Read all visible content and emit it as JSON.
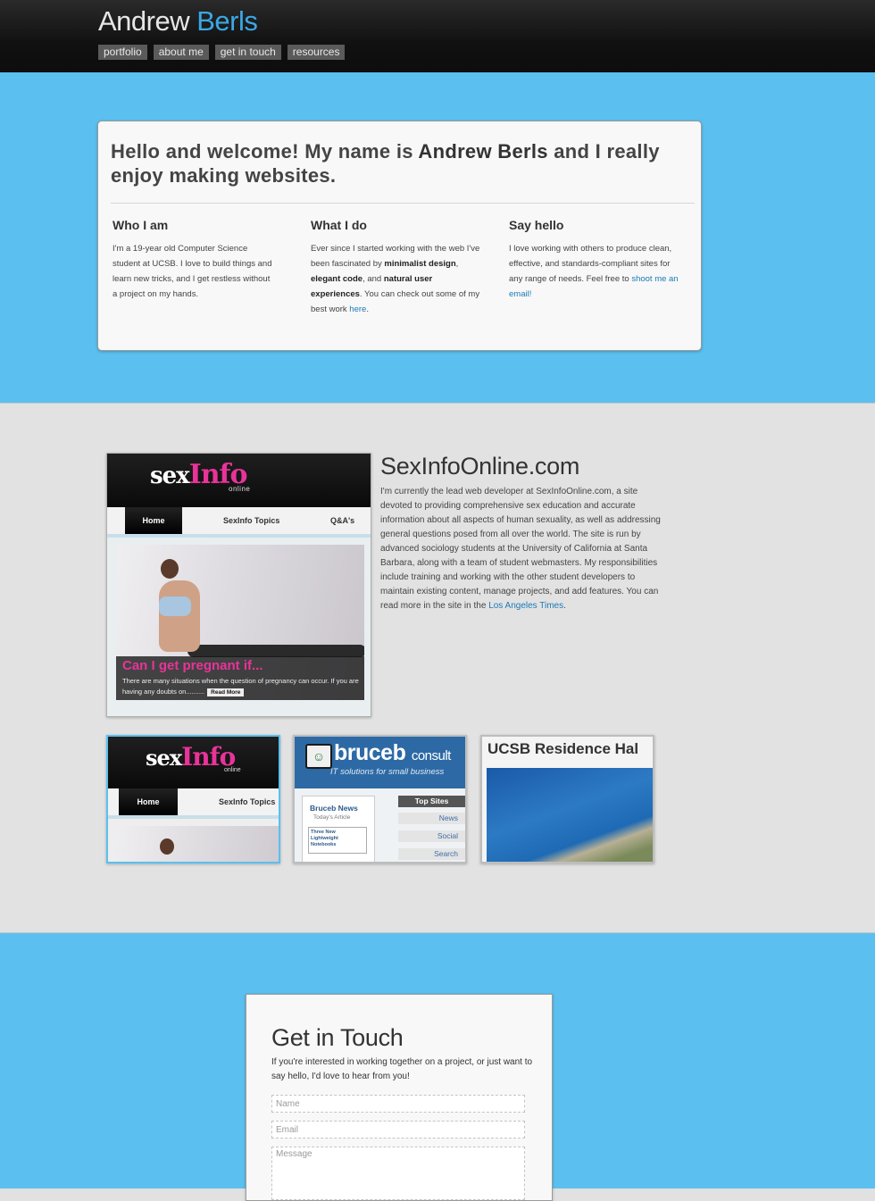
{
  "header": {
    "name_first": "Andrew",
    "name_last": "Berls",
    "nav": [
      "portfolio",
      "about me",
      "get in touch",
      "resources"
    ]
  },
  "intro": {
    "title_part1": "Hello and welcome! My name is ",
    "title_name": "Andrew Berls",
    "title_part2": " and I really enjoy making websites.",
    "columns": [
      {
        "heading": "Who I am",
        "text": "I'm a 19-year old Computer Science student at UCSB. I love to build things and learn new tricks, and I get restless without a project on my hands."
      },
      {
        "heading": "What I do",
        "text_a": "Ever since I started working with the web I've been fascinated by ",
        "bold_1": "minimalist design",
        "text_b": ", ",
        "bold_2": "elegant code",
        "text_c": ", and ",
        "bold_3": "natural user experiences",
        "text_d": ". You can check out some of my best work ",
        "link": "here",
        "text_e": "."
      },
      {
        "heading": "Say hello",
        "text": "I love working with others to produce clean, effective, and standards-compliant sites for any range of needs. Feel free to ",
        "link": "shoot me an email!"
      }
    ]
  },
  "portfolio": {
    "screenshot": {
      "logo_sex": "sex",
      "logo_info": "Info",
      "logo_online": "online",
      "tabs": [
        "Home",
        "SexInfo Topics",
        "Q&A's"
      ],
      "caption_title": "Can I get pregnant if...",
      "caption_text": "There are many situations when the question of pregnancy can occur. If you are having any doubts on..........",
      "read_more": "Read More"
    },
    "project_title": "SexInfoOnline.com",
    "project_desc": "I'm currently the lead web developer at SexInfoOnline.com, a site devoted to providing comprehensive sex education and accurate information about all aspects of human sexuality, as well as addressing general questions posed from all over the world. The site is run by advanced sociology students at the University of California at Santa Barbara, along with a team of student webmasters. My responsibilities include training and working with the other student developers to maintain existing content, manage projects, and add features. You can read more in the site in the ",
    "project_link": "Los Angeles Times",
    "project_end": ".",
    "thumbs": {
      "t1": {
        "logo_sex": "sex",
        "logo_info": "Info",
        "logo_online": "online",
        "tab_home": "Home",
        "tab_topics": "SexInfo Topics"
      },
      "t2": {
        "logo": "bruceb",
        "logo_suffix": "consult",
        "tagline": "IT solutions for small business",
        "news": "Bruceb News",
        "today": "Today's Article",
        "article": "Three New Lightweight Notebooks",
        "side_head": "Top Sites",
        "side_items": [
          "News",
          "Social",
          "Search"
        ]
      },
      "t3": {
        "title": "UCSB Residence Hal"
      }
    }
  },
  "contact": {
    "title": "Get in Touch",
    "text": "If you're interested in working together on a project, or just want to say hello, I'd love to hear from you!",
    "name_placeholder": "Name",
    "email_placeholder": "Email",
    "message_placeholder": "Message"
  },
  "colors": {
    "accent_blue": "#5bc0ef",
    "link_blue": "#1a7ab8",
    "logo_blue": "#3aa8e6",
    "sexinfo_pink": "#e8339a"
  }
}
